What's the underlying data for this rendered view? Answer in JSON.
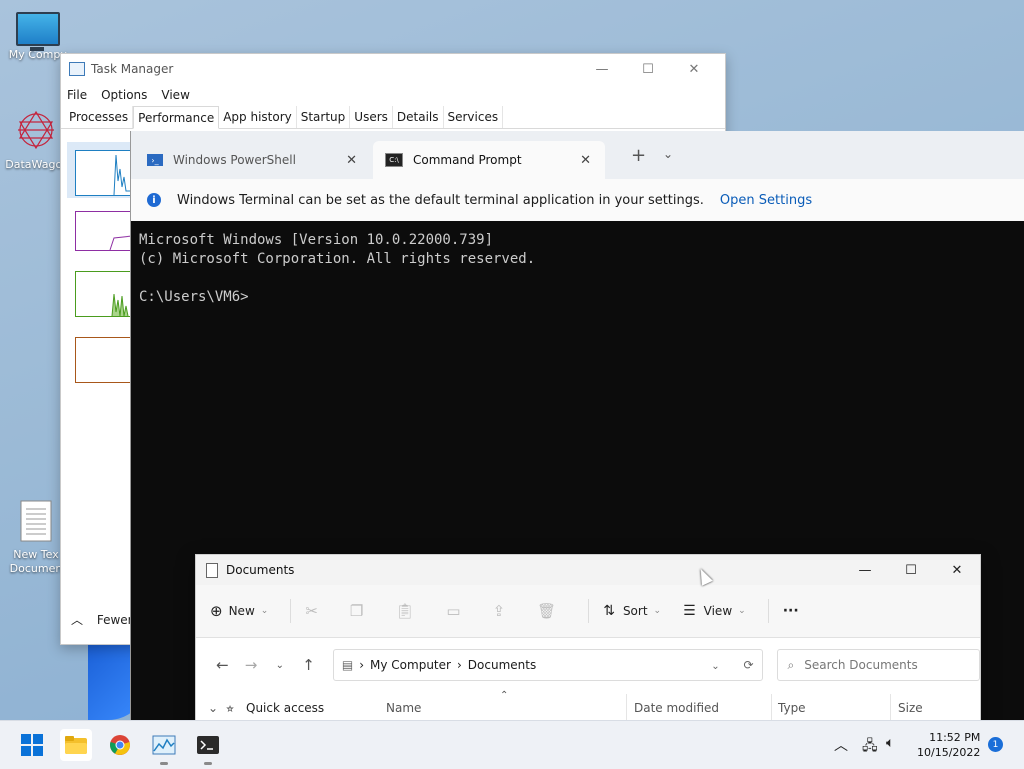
{
  "desktop": {
    "icons": [
      {
        "label": "My Compu"
      },
      {
        "label": "DataWagor"
      },
      {
        "label": "New Tex Documen"
      }
    ]
  },
  "task_manager": {
    "title": "Task Manager",
    "menu": [
      "File",
      "Options",
      "View"
    ],
    "tabs": [
      "Processes",
      "Performance",
      "App history",
      "Startup",
      "Users",
      "Details",
      "Services"
    ],
    "active_tab": "Performance",
    "fewer_details": "Fewer d",
    "graph_colors": [
      "#1e7fc2",
      "#8e2ea3",
      "#4a9c1e",
      "#a8571a"
    ]
  },
  "terminal": {
    "tabs": [
      {
        "label": "Windows PowerShell",
        "active": false
      },
      {
        "label": "Command Prompt",
        "active": true
      }
    ],
    "new_tab": "+",
    "dropdown": "⌄",
    "info_message": "Windows Terminal can be set as the default terminal application in your settings.",
    "info_link": "Open Settings",
    "console_lines": [
      "Microsoft Windows [Version 10.0.22000.739]",
      "(c) Microsoft Corporation. All rights reserved.",
      "",
      "C:\\Users\\VM6>"
    ]
  },
  "explorer": {
    "title": "Documents",
    "toolbar": {
      "new": "New",
      "sort": "Sort",
      "view": "View",
      "more": "···"
    },
    "breadcrumb": [
      "My Computer",
      "Documents"
    ],
    "search_placeholder": "Search Documents",
    "columns": [
      "Name",
      "Date modified",
      "Type",
      "Size"
    ],
    "nav_items": [
      "Quick access"
    ]
  },
  "taskbar": {
    "time": "11:52 PM",
    "date": "10/15/2022",
    "notification_count": "1"
  }
}
